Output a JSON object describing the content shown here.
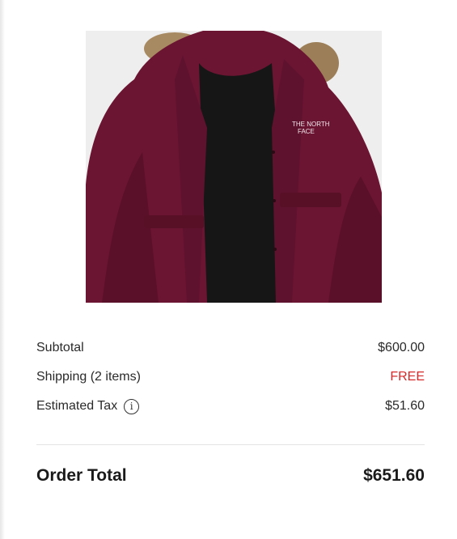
{
  "product": {
    "image_icon": "parka-jacket-image",
    "color": "#6b1533"
  },
  "summary": {
    "subtotal_label": "Subtotal",
    "subtotal_value": "$600.00",
    "shipping_label": "Shipping (2 items)",
    "shipping_value": "FREE",
    "tax_label": "Estimated Tax",
    "tax_value": "$51.60",
    "info_icon": "i"
  },
  "total": {
    "label": "Order Total",
    "value": "$651.60"
  },
  "colors": {
    "free_text": "#d52b2b",
    "divider": "#e4e4e4"
  }
}
